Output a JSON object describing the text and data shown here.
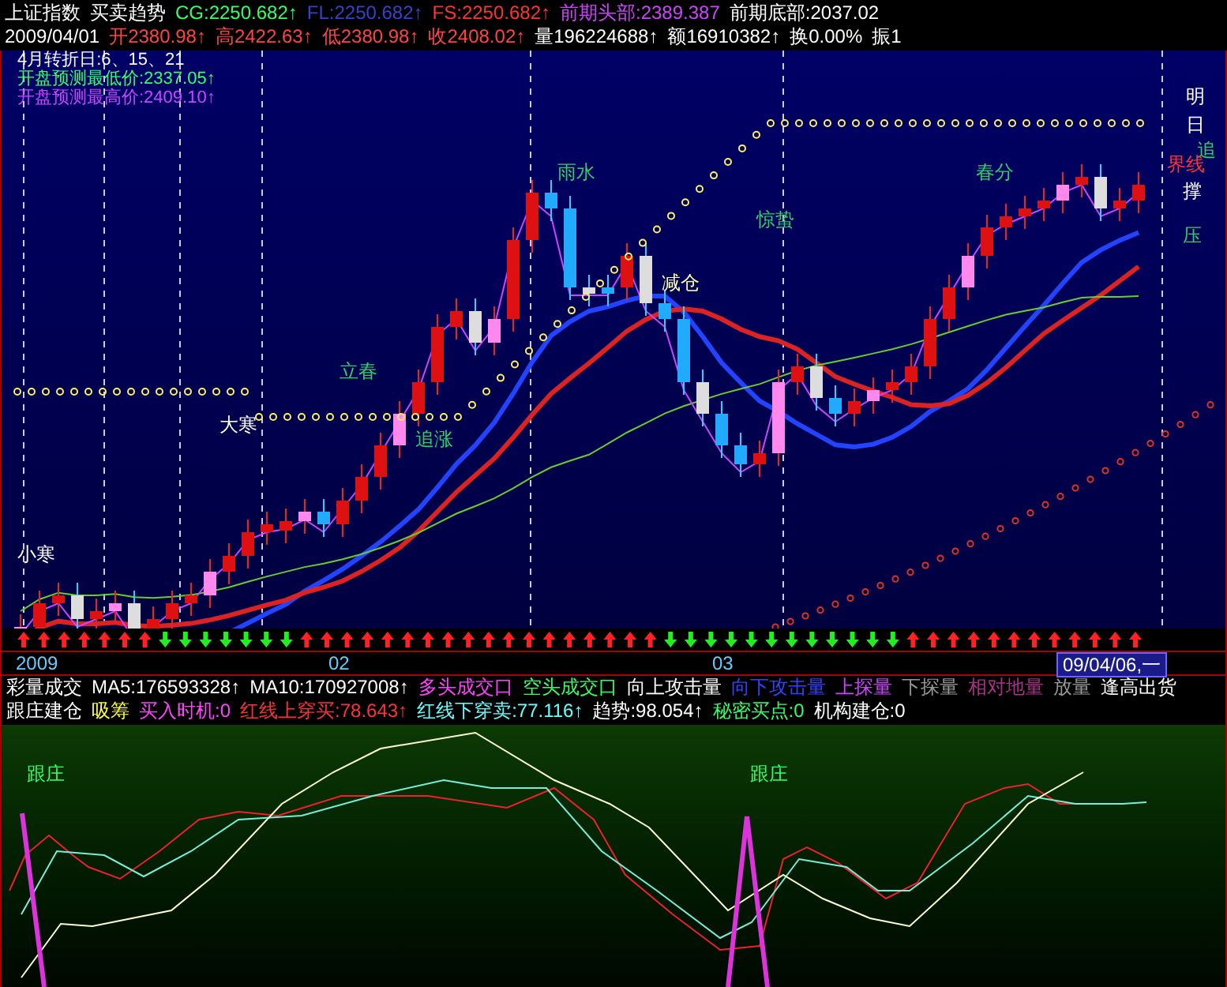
{
  "header": {
    "rows": [
      [
        {
          "text": "上证指数",
          "color": "#ffffff"
        },
        {
          "text": "买卖趋势",
          "color": "#ffffff"
        },
        {
          "text": "CG:2250.682↑",
          "color": "#33ff66"
        },
        {
          "text": "FL:2250.682↑",
          "color": "#3344cc"
        },
        {
          "text": "FS:2250.682↑",
          "color": "#ff3333"
        },
        {
          "text": "前期头部:2389.387",
          "color": "#cc44ff"
        },
        {
          "text": "前期底部:2037.02",
          "color": "#ffffff"
        }
      ],
      [
        {
          "text": "2009/04/01",
          "color": "#ffffff"
        },
        {
          "text": "开2380.98↑",
          "color": "#ff4444"
        },
        {
          "text": "高2422.63↑",
          "color": "#ff4444"
        },
        {
          "text": "低2380.98↑",
          "color": "#ff4444"
        },
        {
          "text": "收2408.02↑",
          "color": "#ff4444"
        },
        {
          "text": "量196224688↑",
          "color": "#ffffff"
        },
        {
          "text": "额16910382↑",
          "color": "#ffffff"
        },
        {
          "text": "换0.00%",
          "color": "#ffffff"
        },
        {
          "text": "振1",
          "color": "#ffffff"
        }
      ]
    ]
  },
  "chart": {
    "info": [
      {
        "text": "4月转折日:6、15、21",
        "color": "#ffffff"
      },
      {
        "text": "开盘预测最低价:2337.05↑",
        "color": "#33ff66"
      },
      {
        "text": "开盘预测最高价:2409.10↑",
        "color": "#cc44ff"
      }
    ],
    "labels": [
      {
        "text": "小寒",
        "color": "#ffffff"
      },
      {
        "text": "大寒",
        "color": "#ffffff"
      },
      {
        "text": "立春",
        "color": "#33cc66"
      },
      {
        "text": "追涨",
        "color": "#33cc66"
      },
      {
        "text": "雨水",
        "color": "#33cc66"
      },
      {
        "text": "减仓",
        "color": "#ffffaa"
      },
      {
        "text": "惊蛰",
        "color": "#33cc66"
      },
      {
        "text": "春分",
        "color": "#33cc66"
      }
    ],
    "side_labels": [
      {
        "text": "明",
        "color": "#ffffff"
      },
      {
        "text": "日",
        "color": "#ffffff"
      },
      {
        "text": "追",
        "color": "#33cc66"
      },
      {
        "text": "界线",
        "color": "#ff3333"
      },
      {
        "text": "撑",
        "color": "#ffffff"
      },
      {
        "text": "压",
        "color": "#33cc66"
      }
    ]
  },
  "date_axis": [
    {
      "text": "2009",
      "kind": "tick"
    },
    {
      "text": "02",
      "kind": "tick"
    },
    {
      "text": "03",
      "kind": "tick"
    },
    {
      "text": "09/04/06,一",
      "kind": "cursor"
    }
  ],
  "indicators": [
    [
      {
        "text": "彩量成交",
        "color": "#ffffff"
      },
      {
        "text": "MA5:176593328↑",
        "color": "#ffffff"
      },
      {
        "text": "MA10:170927008↑",
        "color": "#ffffff"
      },
      {
        "text": "多头成交口",
        "color": "#ff44ff"
      },
      {
        "text": "空头成交口",
        "color": "#33ff66"
      },
      {
        "text": "向上攻击量",
        "color": "#ffffff"
      },
      {
        "text": "向下攻击量",
        "color": "#3344ff"
      },
      {
        "text": "上探量",
        "color": "#cc44ff"
      },
      {
        "text": "下探量",
        "color": "#999999"
      },
      {
        "text": "相对地量",
        "color": "#aa3388"
      },
      {
        "text": "放量",
        "color": "#999999"
      },
      {
        "text": "逢高出货",
        "color": "#ffffff"
      }
    ],
    [
      {
        "text": "跟庄建仓",
        "color": "#ffffff"
      },
      {
        "text": "吸筹",
        "color": "#ffff33"
      },
      {
        "text": "买入时机:0",
        "color": "#ff44ff"
      },
      {
        "text": "红线上穿买:78.643↑",
        "color": "#ff3333"
      },
      {
        "text": "红线下穿卖:77.116↑",
        "color": "#66ffff"
      },
      {
        "text": "趋势:98.054↑",
        "color": "#ffffff"
      },
      {
        "text": "秘密买点:0",
        "color": "#33ff66"
      },
      {
        "text": "机构建仓:0",
        "color": "#ffffff"
      }
    ]
  ],
  "lower_panel": {
    "labels": [
      {
        "text": "跟庄",
        "color": "#33ff66"
      },
      {
        "text": "跟庄",
        "color": "#33ff66"
      }
    ]
  }
}
